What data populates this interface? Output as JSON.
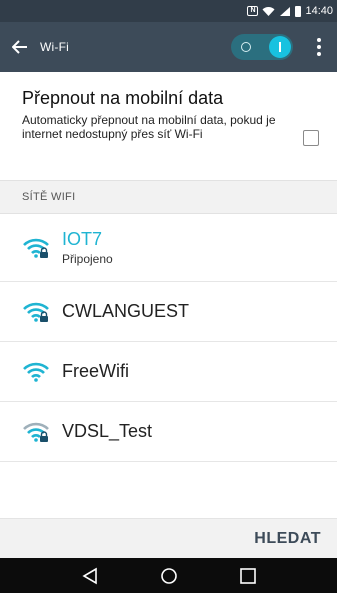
{
  "status_bar": {
    "time": "14:40"
  },
  "app_bar": {
    "title": "Wi-Fi"
  },
  "mobile_data": {
    "title": "Přepnout na mobilní data",
    "description": "Automaticky přepnout na mobilní data, pokud je internet nedostupný přes síť Wi-Fi",
    "checked": false
  },
  "section_header": "SÍTĚ WIFI",
  "networks": [
    {
      "name": "IOT7",
      "status": "Připojeno",
      "connected": true,
      "locked": true
    },
    {
      "name": "CWLANGUEST",
      "status": "",
      "connected": false,
      "locked": true
    },
    {
      "name": "FreeWifi",
      "status": "",
      "connected": false,
      "locked": false
    },
    {
      "name": "VDSL_Test",
      "status": "",
      "connected": false,
      "locked": true
    }
  ],
  "bottom_bar": {
    "search_label": "HLEDAT"
  },
  "colors": {
    "accent": "#1fb4d2",
    "app_bar": "#3d4b59",
    "status_bar": "#313d49"
  }
}
